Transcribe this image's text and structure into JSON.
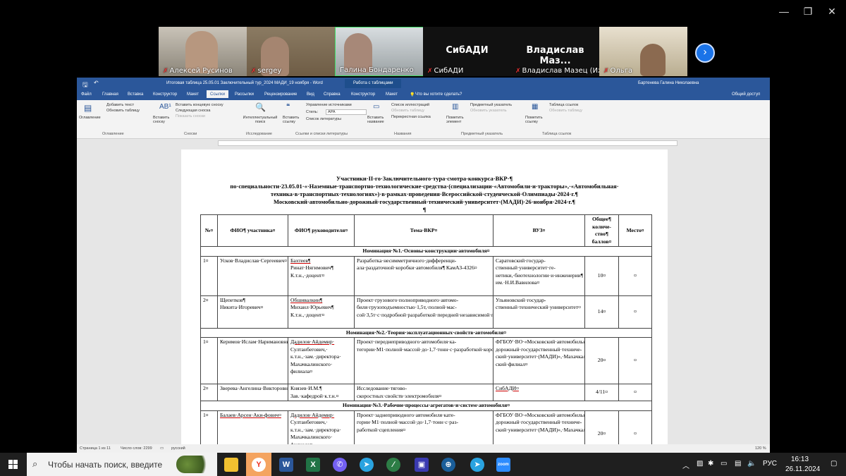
{
  "meeting": {
    "participants": [
      {
        "name": "Алексей Русинов",
        "muted": true
      },
      {
        "name": "sergey",
        "muted": true
      },
      {
        "name": "Галина Бондаренко",
        "muted": false
      },
      {
        "name": "СибАДИ",
        "muted": true,
        "big_label": "СибАДИ"
      },
      {
        "name": "Владислав Мазец (Иж...",
        "muted": true,
        "big_label": "Владислав Маз..."
      },
      {
        "name": "Ольга",
        "muted": true
      }
    ],
    "next_icon": "chevron-right-icon",
    "active_speaker_color": "#3cdc64"
  },
  "word": {
    "title": "Итоговая таблица 25.05.01 Заключительный тур_2024 МАДИ_19 ноября - Word",
    "context_tab": "Работа с таблицами",
    "user": "Бартенева Галина Николаевна",
    "tabs": [
      "Файл",
      "Главная",
      "Вставка",
      "Конструктор",
      "Макет",
      "Ссылки",
      "Рассылки",
      "Рецензирование",
      "Вид",
      "Справка",
      "Конструктор",
      "Макет"
    ],
    "active_tab": "Ссылки",
    "tell_me": "Что вы хотите сделать?",
    "share": "Общий доступ",
    "ribbon": {
      "toc": "Оглавление",
      "add_text": "Добавить текст",
      "update_table": "Обновить таблицу",
      "insert_footnote": "Вставить сноску",
      "insert_endnote": "Вставить концевую сноску",
      "next_footnote": "Следующая сноска",
      "show_notes": "Показать сноски",
      "smart_lookup": "Интеллектуальный поиск",
      "insert_citation": "Вставить ссылку",
      "manage_sources": "Управление источниками",
      "style_label": "Стиль:",
      "style_value": "APA",
      "bibliography": "Список литературы",
      "insert_caption": "Вставить название",
      "table_of_figures": "Список иллюстраций",
      "update_table2": "Обновить таблицу",
      "cross_reference": "Перекрестная ссылка",
      "mark_entry": "Пометить элемент",
      "insert_index": "Предметный указатель",
      "update_index": "Обновить указатель",
      "mark_citation": "Пометить ссылку",
      "table_of_authorities": "Таблица ссылок",
      "update_table3": "Обновить таблицу",
      "groups": [
        "Оглавление",
        "Сноски",
        "Исследование",
        "Ссылки и списки литературы",
        "Названия",
        "Предметный указатель",
        "Таблица ссылок"
      ]
    },
    "document": {
      "heading": [
        "Участники·II-го·Заключительного·тура·смотра-конкурса·ВКР·¶",
        "по·специальности·23.05.01·«·Наземные·транспортно-технологические·средства·(специализации·«Автомобили·и·тракторы»,·«Автомобильная·",
        "техника·в·транспортных·технологиях»)·в·рамках·проведения·Всероссийской·студенческой·Олимпиады·2024·г.¶",
        "Московский·автомобильно-дорожный·государственный·технический·университет·(МАДИ)·26·ноября·2024·г.¶",
        "¶"
      ],
      "table_header": [
        "№¤",
        "ФИО¶ участника¤",
        "ФИО¶ руководителя¤",
        "Тема·ВКР¤",
        "ВУЗ¤",
        "Общее¶ количе-ство¶ баллов¤",
        "Место¤"
      ],
      "sections": [
        {
          "title": "Номинация·№1.·Основы·конструкции·автомобиля¤",
          "rows": [
            {
              "num": "1¤",
              "student": "Усков·Владислав·Сергеевич¤",
              "advisor": [
                "Бахтеев¶",
                "Ринат·Нягимович¶",
                "К.т.н.,·доцент¤"
              ],
              "topic": "Разработка·несимметричного·дифференци-ала·раздаточной·коробки·автомобиля¶ КамАЗ-4326¤",
              "university": "Саратовский·государ-ственный·университет·ге-нетики,·биотехнологии·и·инженерии¶ им.·Н.И.Вавилова¤",
              "score": "10¤",
              "place": "¤"
            },
            {
              "num": "2¤",
              "student": "Щепетков¶ Никита·Игоревич¤",
              "advisor": [
                "Обшивалкин¶",
                "Михаил·Юрьевич¶",
                "К.т.н.,·доцент¤"
              ],
              "topic": "Проект·грузового·полноприводного·автомо-биля·грузоподъемностью·1,5т,·полной·мас-сой·3,5т·с·подробной·разработкой·передней·независимой·подвески¤",
              "university": "Ульяновский·государ-ственный·технический·университет¤",
              "score": "14¤",
              "place": "¤"
            }
          ]
        },
        {
          "title": "Номинация·№2.·Теория·эксплуатационных·свойств·автомобиля¤",
          "rows": [
            {
              "num": "1¤",
              "student": "Керимов·Ислам·Наримановнич¤",
              "advisor": [
                "Дадилов·Айдемир·",
                "Султанбегович,·",
                "к.т.н.,·зам.·директора·",
                "Махачкалинского·",
                "филиала¤"
              ],
              "topic": "Проект·переднеприводного·автомобиля·ка-тегории·М1·полной·массой·до·1,7·тонн·с·разработкой·коробки·передач¤",
              "university": "ФГБОУ·ВО·«Московский·автомобильно-дорожный·государственный·техниче-ский·университет·(МАДИ)»,·Махачкалин-ский·филиал¤",
              "score": "20¤",
              "place": "¤"
            },
            {
              "num": "2¤",
              "student": "Зверева·Ангелина·Викторовна¤",
              "advisor": [
                "Князев·И.М.¶",
                "Зав.·кафедрой·к.т.н.¤"
              ],
              "topic": "Исследование·тягово-скоростных·свойств·электромобиля¤",
              "university": "СибАДИ¤",
              "score": "4/11¤",
              "place": "¤"
            }
          ]
        },
        {
          "title": "Номинация·№3.·Рабочие·процессы·агрегатов·и·систем·автомобиля¤",
          "rows": [
            {
              "num": "1¤",
              "student": "Балаев·Арсен·Аки-фович¤",
              "advisor": [
                "Дадилов·Айдемир·",
                "Султанбегович,·",
                "к.т.н.,·зам.·директора·",
                "Махачкалинского·",
                "филиала¤"
              ],
              "topic": "Проект·заднеприводного·автомобиля·кате-гории·М1·полной·массой·до·1,7·тонн·с·раз-работкой·сцепления¤",
              "university": "ФГБОУ·ВО·«Московский·автомобильно-дорожный·государственный·техниче-ский·университет·(МАДИ)»,·Махачкалин-",
              "score": "20¤",
              "place": "¤"
            }
          ]
        }
      ]
    },
    "status": {
      "page": "Страница 1 из 11",
      "words": "Число слов: 2299",
      "language": "русский",
      "zoom": "120 %"
    }
  },
  "taskbar": {
    "search_placeholder": "Чтобы начать поиск, введите",
    "apps": [
      "file-explorer-icon",
      "yandex-browser-icon",
      "word-icon",
      "excel-icon",
      "viber-icon",
      "telegram-icon",
      "app-icon",
      "save-icon",
      "network-icon",
      "telegram-icon",
      "zoom-icon"
    ],
    "lang": "РУС",
    "time": "16:13",
    "date": "26.11.2024"
  }
}
